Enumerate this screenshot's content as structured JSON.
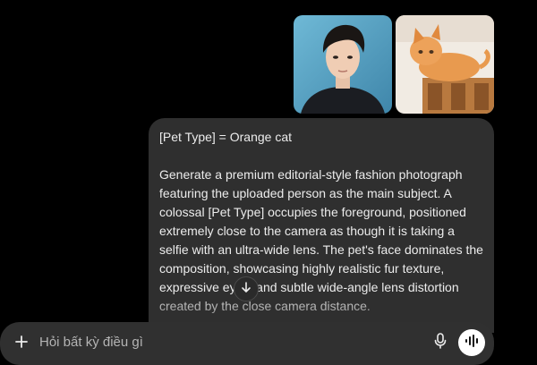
{
  "attachments": [
    {
      "kind": "person-photo",
      "icon": "person-photo-thumbnail"
    },
    {
      "kind": "cat-photo",
      "icon": "orange-cat-photo-thumbnail"
    }
  ],
  "message": {
    "line1": "[Pet Type] = Orange cat",
    "body": "Generate a premium editorial-style fashion photograph featuring the uploaded person as the main subject. A colossal [Pet Type] occupies the foreground, positioned extremely close to the camera as though it is taking a selfie with an ultra-wide lens. The pet's face dominates the composition, showcasing highly realistic fur texture, expressive eyes, and subtle wide-angle lens distortion created by the close camera distance."
  },
  "composer": {
    "placeholder": "Hỏi bất kỳ điều gì",
    "value": ""
  },
  "icons": {
    "scroll": "arrow-down-icon",
    "add": "plus-icon",
    "mic": "microphone-icon",
    "voice": "voice-waveform-icon"
  },
  "colors": {
    "background": "#000000",
    "bubble": "#2f2f2f",
    "composer": "#303030",
    "text": "#ececec"
  }
}
